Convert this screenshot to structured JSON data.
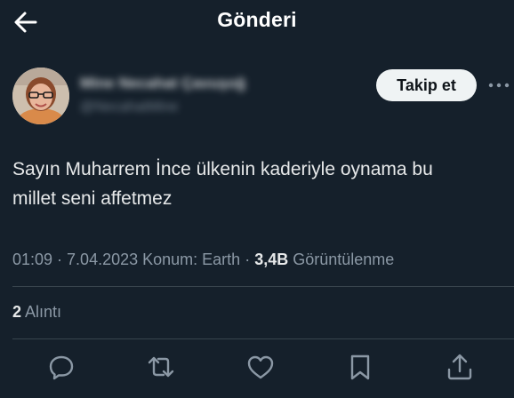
{
  "header": {
    "title": "Gönderi",
    "back_icon": "arrow-left-icon"
  },
  "author": {
    "name": "Mine Necahat Çavuşoğ",
    "handle": "@NecahatMine",
    "avatar_icon": "user-avatar"
  },
  "follow_button": "Takip et",
  "more_icon": "more-horizontal-icon",
  "tweet": {
    "text_line1": "Sayın Muharrem İnce ülkenin kaderiyle oynama bu",
    "text_line2": "millet seni affetmez"
  },
  "meta": {
    "time": "01:09",
    "separator1": " · ",
    "date": "7.04.2023",
    "location": " Konum: Earth",
    "separator2": " · ",
    "views_count": "3,4B",
    "views_label": " Görüntülenme"
  },
  "engagement": {
    "quotes_count": "2",
    "quotes_label": " Alıntı"
  },
  "actions": [
    {
      "icon": "reply-icon"
    },
    {
      "icon": "retweet-icon"
    },
    {
      "icon": "like-icon"
    },
    {
      "icon": "bookmark-icon"
    },
    {
      "icon": "share-icon"
    }
  ],
  "colors": {
    "background": "#15202b",
    "primary_text": "#e7e9ea",
    "secondary_text": "#8b98a5",
    "divider": "#38444d",
    "follow_button_bg": "#eff3f4"
  }
}
